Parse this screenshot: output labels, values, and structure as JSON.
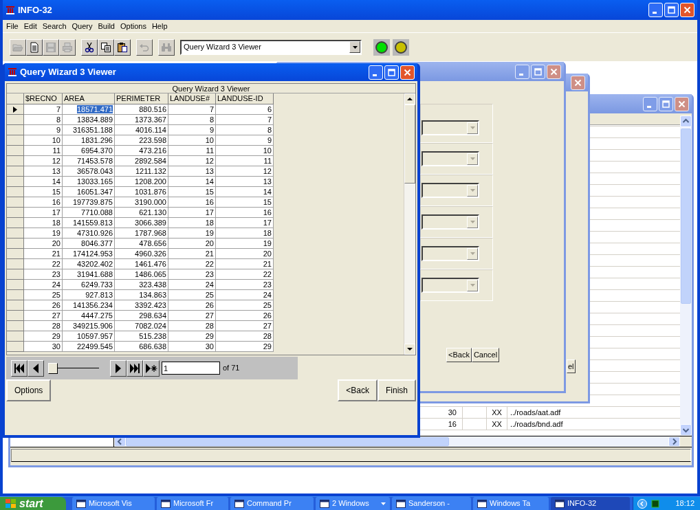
{
  "main_window": {
    "title": "INFO-32",
    "active": true
  },
  "menu": [
    {
      "label": "File"
    },
    {
      "label": "Edit"
    },
    {
      "label": "Search"
    },
    {
      "label": "Query"
    },
    {
      "label": "Build"
    },
    {
      "label": "Options"
    },
    {
      "label": "Help"
    }
  ],
  "toolbar": {
    "groups": [
      {
        "buttons": [
          {
            "kind": "open",
            "disabled": true
          },
          {
            "kind": "new",
            "disabled": false
          },
          {
            "kind": "save",
            "disabled": true
          },
          {
            "kind": "print",
            "disabled": true
          }
        ]
      },
      {
        "buttons": [
          {
            "kind": "cut",
            "disabled": false
          },
          {
            "kind": "copy",
            "disabled": false
          },
          {
            "kind": "paste",
            "disabled": false
          }
        ]
      },
      {
        "buttons": [
          {
            "kind": "undo",
            "disabled": true
          }
        ]
      },
      {
        "buttons": [
          {
            "kind": "find",
            "disabled": true
          }
        ]
      }
    ],
    "view_selector": {
      "value": "Query Wizard 3 Viewer"
    },
    "lights": [
      {
        "color": "#00e000"
      },
      {
        "color": "#c8c000"
      }
    ]
  },
  "table_window": {
    "active": false,
    "rows": [
      {
        "column_1": "30",
        "column_3": "XX",
        "column_4": "../roads/aat.adf"
      },
      {
        "column_1": "16",
        "column_3": "XX",
        "column_4": "../roads/bnd.adf"
      }
    ]
  },
  "wizard_window_back": {
    "active": false,
    "buttons": [
      {
        "label": "el"
      }
    ]
  },
  "wizard_window": {
    "active": false,
    "fields": [
      {
        "disabled": true
      },
      {
        "disabled": true
      },
      {
        "disabled": true
      },
      {
        "disabled": true
      },
      {
        "disabled": true
      },
      {
        "disabled": true
      }
    ],
    "buttons": [
      {
        "label": "<Back"
      },
      {
        "label": "Cancel"
      }
    ]
  },
  "viewer": {
    "title": "Query Wizard 3 Viewer",
    "active": true,
    "grid": {
      "caption": "Query Wizard 3 Viewer",
      "columns": [
        {
          "label": "$RECNO",
          "focused": false
        },
        {
          "label": "AREA",
          "focused": true
        },
        {
          "label": "PERIMETER",
          "focused": false
        },
        {
          "label": "LANDUSE#",
          "focused": false
        },
        {
          "label": "LANDUSE-ID",
          "focused": false
        }
      ],
      "rows": [
        {
          "selected": true,
          "cells": [
            "7",
            "18571.471",
            "880.516",
            "7",
            "6"
          ]
        },
        {
          "selected": false,
          "cells": [
            "8",
            "13834.889",
            "1373.367",
            "8",
            "7"
          ]
        },
        {
          "selected": false,
          "cells": [
            "9",
            "316351.188",
            "4016.114",
            "9",
            "8"
          ]
        },
        {
          "selected": false,
          "cells": [
            "10",
            "1831.296",
            "223.598",
            "10",
            "9"
          ]
        },
        {
          "selected": false,
          "cells": [
            "11",
            "6954.370",
            "473.216",
            "11",
            "10"
          ]
        },
        {
          "selected": false,
          "cells": [
            "12",
            "71453.578",
            "2892.584",
            "12",
            "11"
          ]
        },
        {
          "selected": false,
          "cells": [
            "13",
            "36578.043",
            "1211.132",
            "13",
            "12"
          ]
        },
        {
          "selected": false,
          "cells": [
            "14",
            "13033.165",
            "1208.200",
            "14",
            "13"
          ]
        },
        {
          "selected": false,
          "cells": [
            "15",
            "16051.347",
            "1031.876",
            "15",
            "14"
          ]
        },
        {
          "selected": false,
          "cells": [
            "16",
            "197739.875",
            "3190.000",
            "16",
            "15"
          ]
        },
        {
          "selected": false,
          "cells": [
            "17",
            "7710.088",
            "621.130",
            "17",
            "16"
          ]
        },
        {
          "selected": false,
          "cells": [
            "18",
            "141559.813",
            "3066.389",
            "18",
            "17"
          ]
        },
        {
          "selected": false,
          "cells": [
            "19",
            "47310.926",
            "1787.968",
            "19",
            "18"
          ]
        },
        {
          "selected": false,
          "cells": [
            "20",
            "8046.377",
            "478.656",
            "20",
            "19"
          ]
        },
        {
          "selected": false,
          "cells": [
            "21",
            "174124.953",
            "4960.326",
            "21",
            "20"
          ]
        },
        {
          "selected": false,
          "cells": [
            "22",
            "43202.402",
            "1461.476",
            "22",
            "21"
          ]
        },
        {
          "selected": false,
          "cells": [
            "23",
            "31941.688",
            "1486.065",
            "23",
            "22"
          ]
        },
        {
          "selected": false,
          "cells": [
            "24",
            "6249.733",
            "323.438",
            "24",
            "23"
          ]
        },
        {
          "selected": false,
          "cells": [
            "25",
            "927.813",
            "134.863",
            "25",
            "24"
          ]
        },
        {
          "selected": false,
          "cells": [
            "26",
            "141356.234",
            "3392.423",
            "26",
            "25"
          ]
        },
        {
          "selected": false,
          "cells": [
            "27",
            "4447.275",
            "298.634",
            "27",
            "26"
          ]
        },
        {
          "selected": false,
          "cells": [
            "28",
            "349215.906",
            "7082.024",
            "28",
            "27"
          ]
        },
        {
          "selected": false,
          "cells": [
            "29",
            "10597.957",
            "515.238",
            "29",
            "28"
          ]
        },
        {
          "selected": false,
          "cells": [
            "30",
            "22499.545",
            "686.638",
            "30",
            "29"
          ]
        }
      ]
    },
    "navigator": {
      "position": {
        "level": 0
      },
      "record": "1",
      "count": "of 71"
    },
    "left_buttons": [
      {
        "label": "Options"
      }
    ],
    "right_buttons": [
      {
        "label": "<Back"
      },
      {
        "label": "Finish"
      }
    ]
  },
  "taskbar": {
    "start": "start",
    "items": [
      {
        "label": "Microsoft Vis",
        "grouped": false,
        "active": false
      },
      {
        "label": "Microsoft Fr",
        "grouped": false,
        "active": false
      },
      {
        "label": "Command Pr",
        "grouped": false,
        "active": false
      },
      {
        "label": "2 Windows",
        "grouped": true,
        "active": false
      },
      {
        "label": "Sanderson -",
        "grouped": false,
        "active": false
      },
      {
        "label": "Windows Ta",
        "grouped": false,
        "active": false
      },
      {
        "label": "INFO-32",
        "grouped": false,
        "active": true
      }
    ],
    "clock": "18:12"
  }
}
